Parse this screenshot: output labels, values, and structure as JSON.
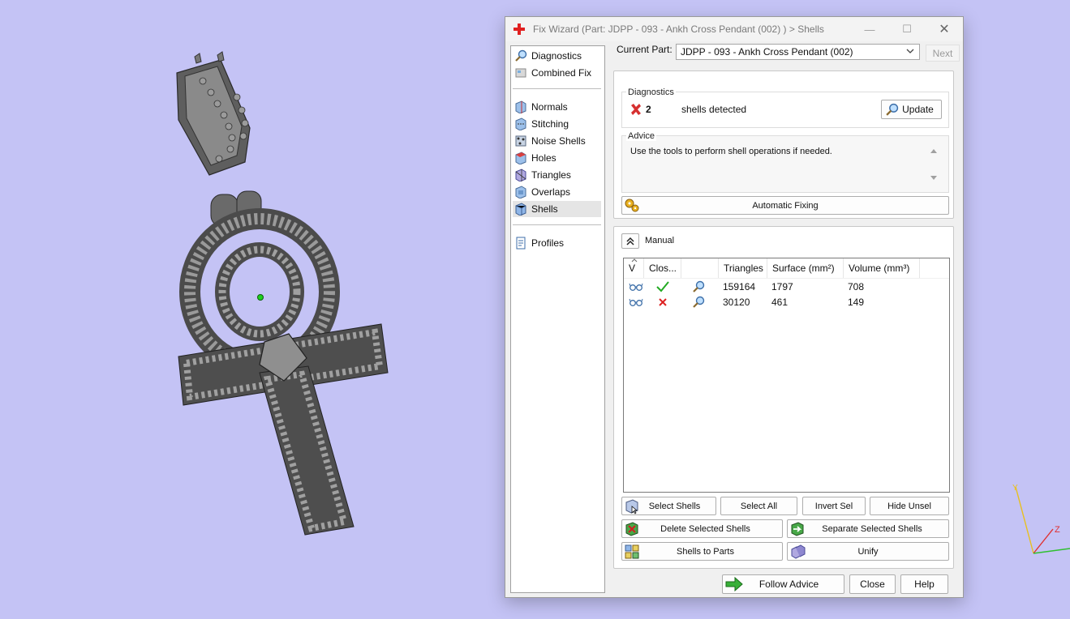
{
  "dialog": {
    "title": "Fix Wizard (Part: JDPP - 093 - Ankh Cross Pendant (002)  ) > Shells",
    "window_controls": {
      "minimize": "—",
      "maximize": "☐",
      "close": "✕"
    }
  },
  "nav": {
    "items": [
      {
        "label": "Diagnostics",
        "icon": "magnifier-icon"
      },
      {
        "label": "Combined Fix",
        "icon": "combined-fix-icon"
      },
      {
        "label": "Normals",
        "icon": "normals-icon"
      },
      {
        "label": "Stitching",
        "icon": "stitching-icon"
      },
      {
        "label": "Noise Shells",
        "icon": "noise-shells-icon"
      },
      {
        "label": "Holes",
        "icon": "holes-icon"
      },
      {
        "label": "Triangles",
        "icon": "triangles-icon"
      },
      {
        "label": "Overlaps",
        "icon": "overlaps-icon"
      },
      {
        "label": "Shells",
        "icon": "shells-icon",
        "selected": true
      },
      {
        "label": "Profiles",
        "icon": "profiles-icon"
      }
    ]
  },
  "current_part": {
    "label": "Current Part:",
    "value": "JDPP - 093 - Ankh Cross Pendant (002)",
    "next": "Next"
  },
  "diagnostics": {
    "title": "Diagnostics",
    "count": "2",
    "text": "shells detected",
    "update": "Update"
  },
  "advice": {
    "title": "Advice",
    "text": "Use the tools to perform shell operations if needed.",
    "automatic_fixing": "Automatic Fixing"
  },
  "manual": {
    "title": "Manual",
    "table": {
      "headers": [
        "V",
        "Clos...",
        "",
        "Triangles",
        "Surface (mm²)",
        "Volume (mm³)"
      ],
      "rows": [
        {
          "closed": true,
          "triangles": "159164",
          "surface": "1797",
          "volume": "708"
        },
        {
          "closed": false,
          "triangles": "30120",
          "surface": "461",
          "volume": "149"
        }
      ]
    },
    "buttons": {
      "select_shells": "Select Shells",
      "select_all": "Select All",
      "invert_sel": "Invert Sel",
      "hide_unsel": "Hide Unsel",
      "delete_selected": "Delete Selected Shells",
      "separate_selected": "Separate Selected Shells",
      "shells_to_parts": "Shells to Parts",
      "unify": "Unify"
    }
  },
  "footer": {
    "follow_advice": "Follow Advice",
    "close": "Close",
    "help": "Help"
  },
  "axes": {
    "y": "Y",
    "z": "Z"
  },
  "colors": {
    "viewport_bg": "#c4c3f5",
    "check_green": "#22aa22",
    "error_red": "#dd2222",
    "axis_y": "#e8c020",
    "axis_z": "#e03030",
    "axis_x": "#30c030"
  }
}
